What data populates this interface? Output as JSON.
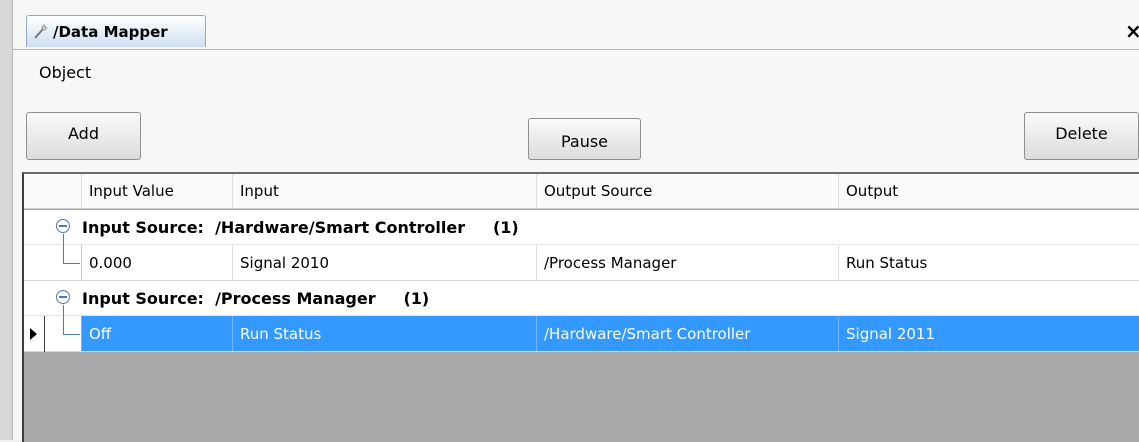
{
  "window": {
    "tab_title": "/Data Mapper",
    "close_glyph": "×",
    "tab_icon": "wand-icon"
  },
  "menu": {
    "object_label": "Object"
  },
  "toolbar": {
    "add_label": "Add",
    "pause_label": "Pause",
    "delete_label": "Delete"
  },
  "grid": {
    "columns": [
      "Input Value",
      "Input",
      "Output Source",
      "Output"
    ],
    "groups": [
      {
        "label": "Input Source:  /Hardware/Smart Controller     (1)",
        "rows": [
          {
            "input_value": "0.000",
            "input": "Signal 2010",
            "output_source": "/Process Manager",
            "output": "Run Status",
            "selected": false
          }
        ]
      },
      {
        "label": "Input Source:  /Process Manager     (1)",
        "rows": [
          {
            "input_value": "Off",
            "input": "Run Status",
            "output_source": "/Hardware/Smart Controller",
            "output": "Signal 2011",
            "selected": true
          }
        ]
      }
    ]
  },
  "colors": {
    "selection": "#3399ff",
    "tree_line": "#4b7bb5",
    "empty_area": "#a9a9a9"
  }
}
